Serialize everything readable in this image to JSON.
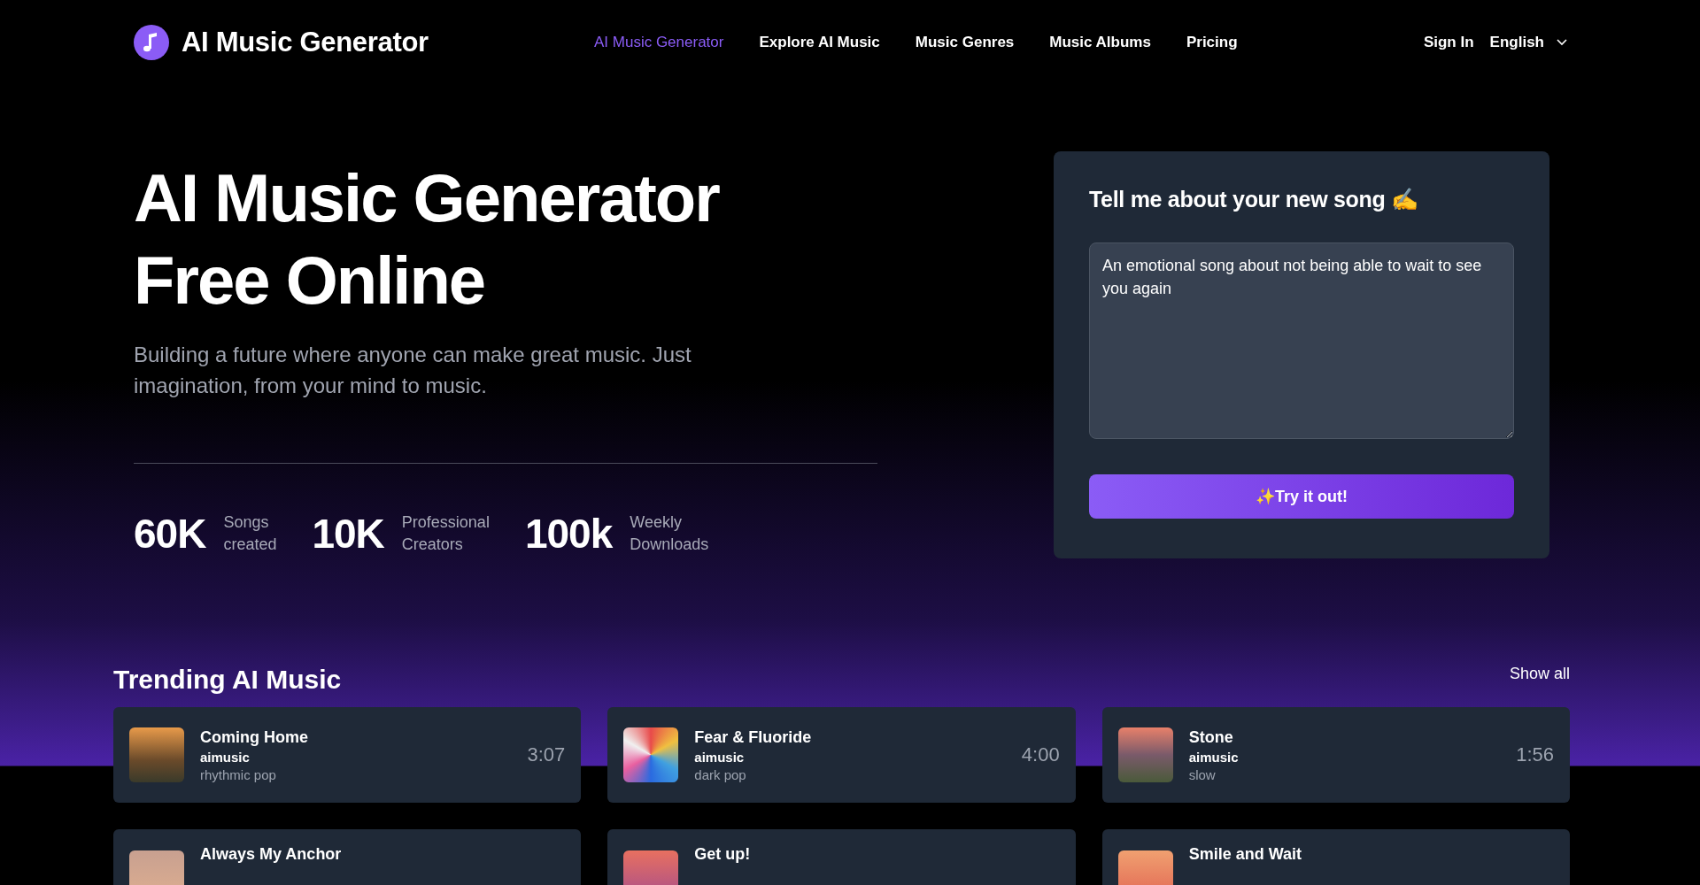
{
  "header": {
    "logo_text": "AI Music Generator",
    "nav": [
      {
        "label": "AI Music Generator",
        "selected": true
      },
      {
        "label": "Explore AI Music",
        "selected": false
      },
      {
        "label": "Music Genres",
        "selected": false
      },
      {
        "label": "Music Albums",
        "selected": false
      },
      {
        "label": "Pricing",
        "selected": false
      }
    ],
    "sign_in": "Sign In",
    "language": "English"
  },
  "hero": {
    "title_lines": [
      "AI Music Generator",
      "Free Online"
    ],
    "subtitle": "Building a future where anyone can make great music. Just imagination, from your mind to music.",
    "stats": [
      {
        "value": "60K",
        "label_lines": [
          "Songs",
          "created"
        ]
      },
      {
        "value": "10K",
        "label_lines": [
          "Professional",
          "Creators"
        ]
      },
      {
        "value": "100k",
        "label_lines": [
          "Weekly",
          "Downloads"
        ]
      }
    ]
  },
  "prompt_card": {
    "title": "Tell me about your new song ✍️",
    "value": "An emotional song about not being able to wait to see you again",
    "button": "✨Try it out!"
  },
  "trending": {
    "title": "Trending AI Music",
    "show_all": "Show all",
    "songs": [
      {
        "title": "Coming Home",
        "artist": "aimusic",
        "genre": "rhythmic pop",
        "duration": "3:07"
      },
      {
        "title": "Fear & Fluoride",
        "artist": "aimusic",
        "genre": "dark pop",
        "duration": "4:00"
      },
      {
        "title": "Stone",
        "artist": "aimusic",
        "genre": "slow",
        "duration": "1:56"
      },
      {
        "title": "Always My Anchor"
      },
      {
        "title": "Get up!"
      },
      {
        "title": "Smile and Wait"
      }
    ]
  }
}
